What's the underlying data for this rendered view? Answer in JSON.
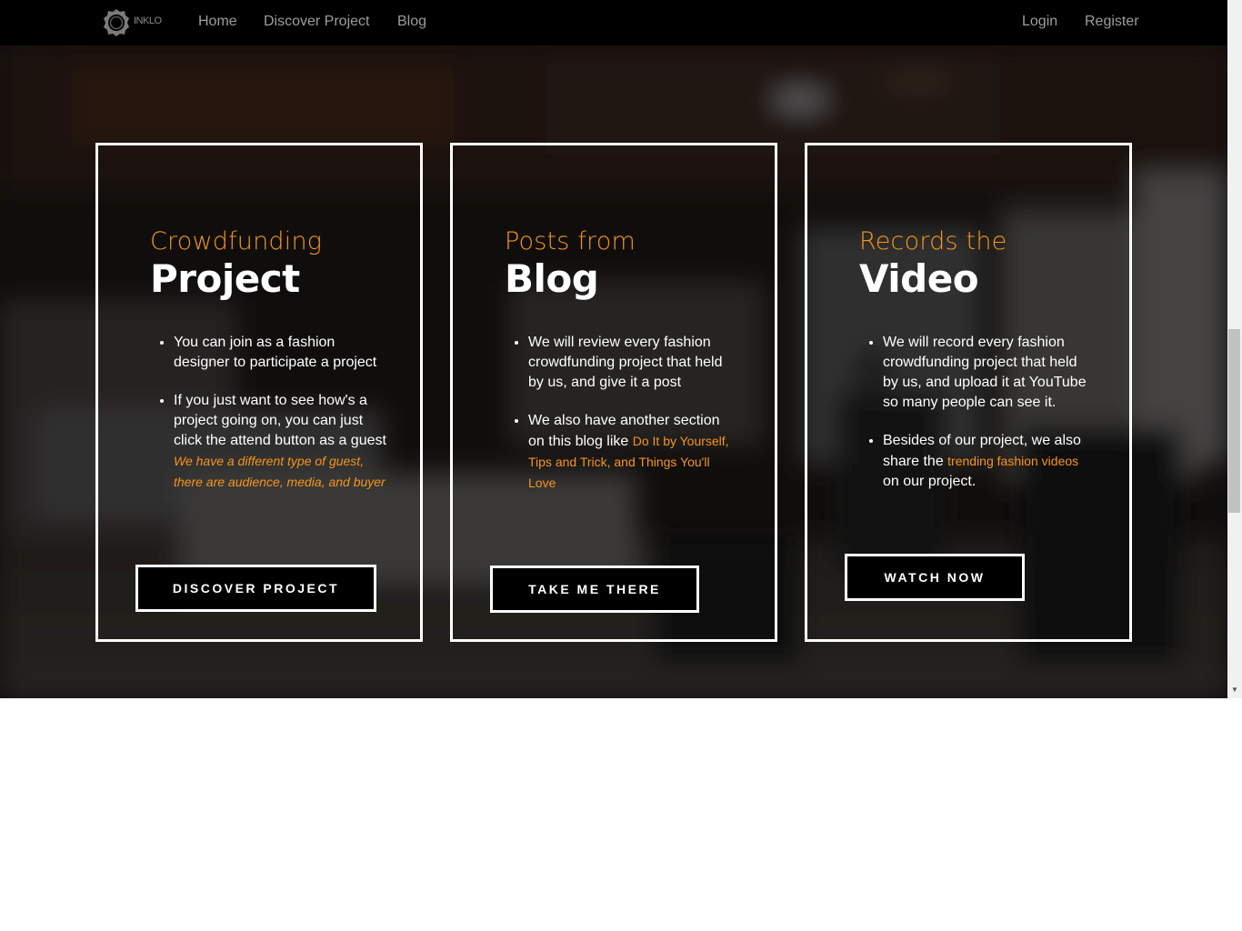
{
  "navbar": {
    "logo_text": "INKLO",
    "links": [
      "Home",
      "Discover Project",
      "Blog"
    ],
    "right_links": [
      "Login",
      "Register"
    ]
  },
  "cards": [
    {
      "kicker": "Crowdfunding",
      "title": "Project",
      "bullets": [
        {
          "text": "You can join as a fashion designer to participate a project"
        },
        {
          "text": "If you just want to see how's a project going on, you can just click the attend button as a guest ",
          "highlight": "We have a different type of guest, there are audience, media, and buyer"
        }
      ],
      "button": "DISCOVER PROJECT"
    },
    {
      "kicker": "Posts from",
      "title": "Blog",
      "bullets": [
        {
          "text": "We will review every fashion crowdfunding project that held by us, and give it a post"
        },
        {
          "text": "We also have another section on this blog like ",
          "highlight": "Do It by Yourself, Tips and Trick, and Things You'll Love"
        }
      ],
      "button": "TAKE ME THERE"
    },
    {
      "kicker": "Records the",
      "title": "Video",
      "bullets": [
        {
          "text": "We will record every fashion crowdfunding project that held by us, and upload it at YouTube so many people can see it."
        },
        {
          "text": "Besides of our project, we also share the ",
          "highlight": "trending fashion videos",
          "after": " on our project."
        }
      ],
      "button": "WATCH NOW"
    }
  ],
  "colors": {
    "accent": "#f7941d",
    "navbar_bg": "#000000",
    "nav_text": "#9d9d9d",
    "card_border": "#ffffff"
  },
  "icons": {
    "logo": "gear-ring-logo-icon",
    "scroll_down": "scroll-down-arrow-icon"
  }
}
